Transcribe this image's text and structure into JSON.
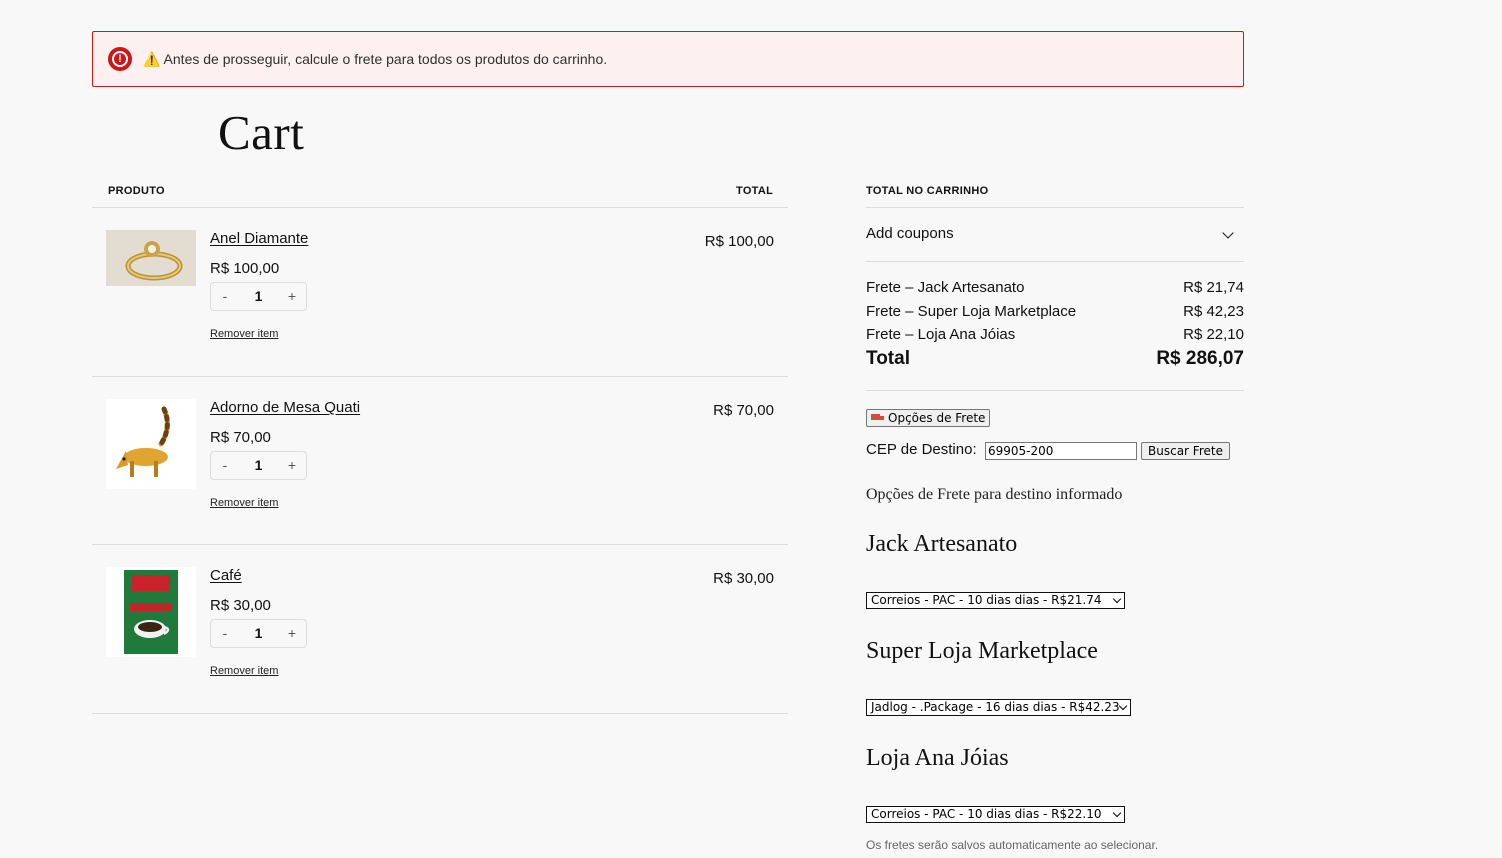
{
  "notice": {
    "text": "⚠️ Antes de prosseguir, calcule o frete para todos os produtos do carrinho."
  },
  "page": {
    "title": "Cart"
  },
  "table": {
    "col_product": "PRODUTO",
    "col_total": "TOTAL"
  },
  "items": [
    {
      "name": "Anel Diamante",
      "price": "R$ 100,00",
      "quantity": "1",
      "total": "R$ 100,00",
      "remove": "Remover item",
      "decrease": "-",
      "increase": "+"
    },
    {
      "name": "Adorno de Mesa Quati",
      "price": "R$ 70,00",
      "quantity": "1",
      "total": "R$ 70,00",
      "remove": "Remover item",
      "decrease": "-",
      "increase": "+"
    },
    {
      "name": "Café",
      "price": "R$ 30,00",
      "quantity": "1",
      "total": "R$ 30,00",
      "remove": "Remover item",
      "decrease": "-",
      "increase": "+"
    }
  ],
  "summary": {
    "heading": "TOTAL NO CARRINHO",
    "coupon_label": "Add coupons",
    "fees": [
      {
        "label": "Frete – Jack Artesanato",
        "value": "R$ 21,74"
      },
      {
        "label": "Frete – Super Loja Marketplace",
        "value": "R$ 42,23"
      },
      {
        "label": "Frete – Loja Ana Jóias",
        "value": "R$ 22,10"
      }
    ],
    "total_label": "Total",
    "total_value": "R$ 286,07"
  },
  "shipping": {
    "options_button": "Opções de Frete",
    "cep_label": "CEP de Destino:",
    "cep_value": "69905-200",
    "search_button": "Buscar Frete",
    "options_title": "Opções de Frete para destino informado",
    "stores": [
      {
        "name": "Jack Artesanato",
        "selected": "Correios - PAC - 10 dias dias - R$21.74"
      },
      {
        "name": "Super Loja Marketplace",
        "selected": "Jadlog - .Package - 16 dias dias - R$42.23"
      },
      {
        "name": "Loja Ana Jóias",
        "selected": "Correios - PAC - 10 dias dias - R$22.10"
      }
    ],
    "footnote": "Os fretes serão salvos automaticamente ao selecionar."
  },
  "colors": {
    "notice_border": "#cc1818",
    "notice_bg": "#fcf0f1",
    "page_bg": "#f8f8f8"
  }
}
